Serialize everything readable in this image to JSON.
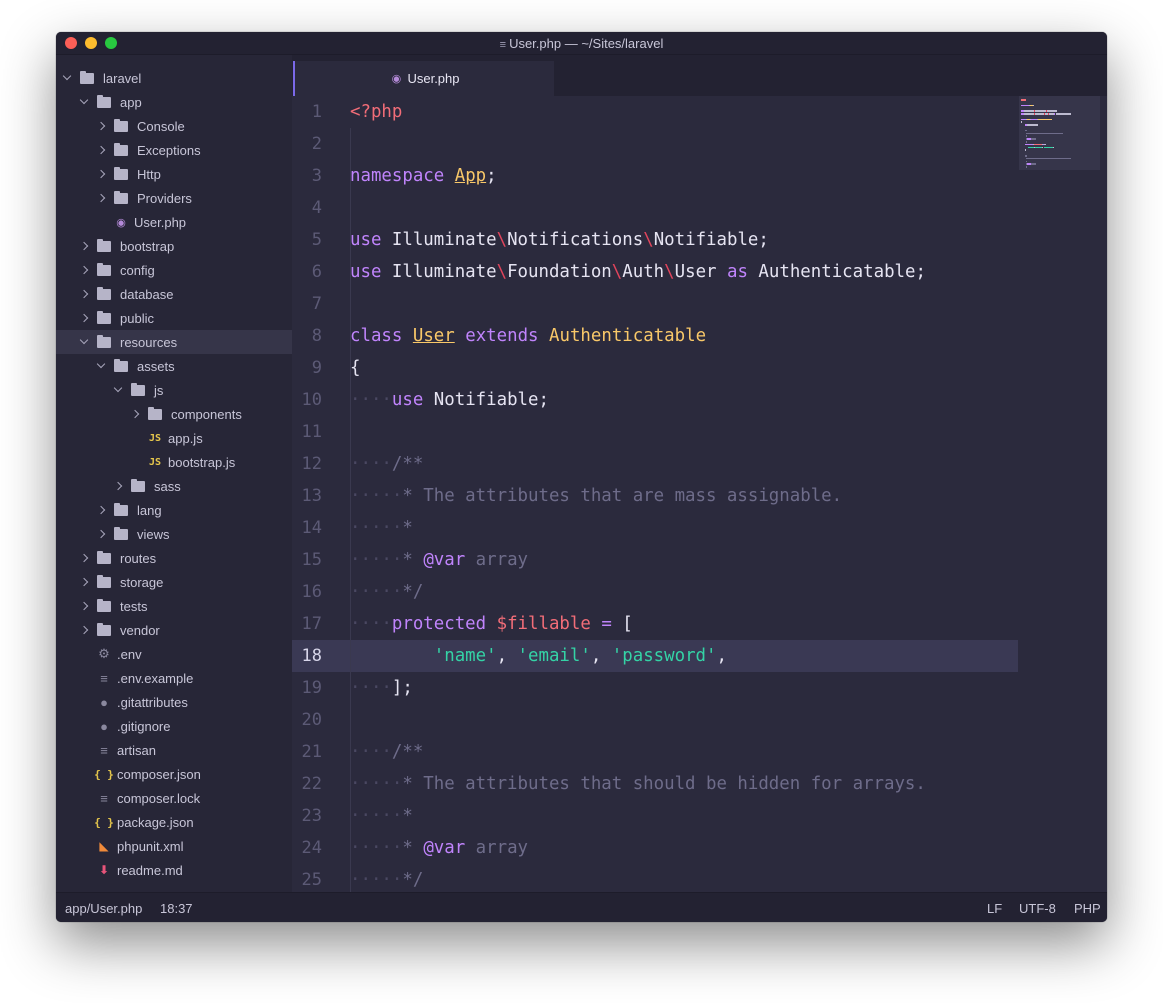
{
  "window": {
    "title": "User.php — ~/Sites/laravel"
  },
  "sidebar": {
    "items": [
      {
        "label": "laravel",
        "type": "folder",
        "state": "open",
        "depth": 0
      },
      {
        "label": "app",
        "type": "folder",
        "state": "open",
        "depth": 1
      },
      {
        "label": "Console",
        "type": "folder",
        "state": "closed",
        "depth": 2
      },
      {
        "label": "Exceptions",
        "type": "folder",
        "state": "closed",
        "depth": 2
      },
      {
        "label": "Http",
        "type": "folder",
        "state": "closed",
        "depth": 2
      },
      {
        "label": "Providers",
        "type": "folder",
        "state": "closed",
        "depth": 2
      },
      {
        "label": "User.php",
        "type": "file",
        "icon": "php-elephant-icon",
        "depth": 2
      },
      {
        "label": "bootstrap",
        "type": "folder",
        "state": "closed",
        "depth": 1
      },
      {
        "label": "config",
        "type": "folder",
        "state": "closed",
        "depth": 1
      },
      {
        "label": "database",
        "type": "folder",
        "state": "closed",
        "depth": 1
      },
      {
        "label": "public",
        "type": "folder",
        "state": "closed",
        "depth": 1
      },
      {
        "label": "resources",
        "type": "folder",
        "state": "open",
        "depth": 1,
        "selected": true
      },
      {
        "label": "assets",
        "type": "folder",
        "state": "open",
        "depth": 2
      },
      {
        "label": "js",
        "type": "folder",
        "state": "open",
        "depth": 3
      },
      {
        "label": "components",
        "type": "folder",
        "state": "closed",
        "depth": 4
      },
      {
        "label": "app.js",
        "type": "file",
        "icon": "js-icon",
        "depth": 4
      },
      {
        "label": "bootstrap.js",
        "type": "file",
        "icon": "js-icon",
        "depth": 4
      },
      {
        "label": "sass",
        "type": "folder",
        "state": "closed",
        "depth": 3
      },
      {
        "label": "lang",
        "type": "folder",
        "state": "closed",
        "depth": 2
      },
      {
        "label": "views",
        "type": "folder",
        "state": "closed",
        "depth": 2
      },
      {
        "label": "routes",
        "type": "folder",
        "state": "closed",
        "depth": 1
      },
      {
        "label": "storage",
        "type": "folder",
        "state": "closed",
        "depth": 1
      },
      {
        "label": "tests",
        "type": "folder",
        "state": "closed",
        "depth": 1
      },
      {
        "label": "vendor",
        "type": "folder",
        "state": "closed",
        "depth": 1
      },
      {
        "label": ".env",
        "type": "file",
        "icon": "gear-icon",
        "depth": 1
      },
      {
        "label": ".env.example",
        "type": "file",
        "icon": "text-file-icon",
        "depth": 1
      },
      {
        "label": ".gitattributes",
        "type": "file",
        "icon": "github-icon",
        "depth": 1
      },
      {
        "label": ".gitignore",
        "type": "file",
        "icon": "github-icon",
        "depth": 1
      },
      {
        "label": "artisan",
        "type": "file",
        "icon": "text-file-icon",
        "depth": 1
      },
      {
        "label": "composer.json",
        "type": "file",
        "icon": "json-braces-icon",
        "depth": 1
      },
      {
        "label": "composer.lock",
        "type": "file",
        "icon": "text-file-icon",
        "depth": 1
      },
      {
        "label": "package.json",
        "type": "file",
        "icon": "json-braces-icon",
        "depth": 1
      },
      {
        "label": "phpunit.xml",
        "type": "file",
        "icon": "rss-feed-icon",
        "depth": 1
      },
      {
        "label": "readme.md",
        "type": "file",
        "icon": "markdown-arrow-icon",
        "depth": 1
      }
    ]
  },
  "tabs": [
    {
      "label": "User.php",
      "icon": "php-elephant-icon",
      "active": true
    }
  ],
  "editor": {
    "current_line": 18,
    "lines": [
      {
        "n": "1",
        "indent": 0,
        "tokens": [
          {
            "t": "<?php",
            "c": "tg"
          }
        ]
      },
      {
        "n": "2",
        "indent": 0,
        "tokens": []
      },
      {
        "n": "3",
        "indent": 0,
        "tokens": [
          {
            "t": "namespace",
            "c": "k"
          },
          {
            "t": " "
          },
          {
            "t": "App",
            "c": "cls ul"
          },
          {
            "t": ";"
          }
        ]
      },
      {
        "n": "4",
        "indent": 0,
        "tokens": []
      },
      {
        "n": "5",
        "indent": 0,
        "tokens": [
          {
            "t": "use",
            "c": "k"
          },
          {
            "t": " Illuminate"
          },
          {
            "t": "\\",
            "c": "bs"
          },
          {
            "t": "Notifications"
          },
          {
            "t": "\\",
            "c": "bs"
          },
          {
            "t": "Notifiable;"
          }
        ]
      },
      {
        "n": "6",
        "indent": 0,
        "tokens": [
          {
            "t": "use",
            "c": "k"
          },
          {
            "t": " Illuminate"
          },
          {
            "t": "\\",
            "c": "bs"
          },
          {
            "t": "Foundation"
          },
          {
            "t": "\\",
            "c": "bs"
          },
          {
            "t": "Auth"
          },
          {
            "t": "\\",
            "c": "bs"
          },
          {
            "t": "User "
          },
          {
            "t": "as",
            "c": "k"
          },
          {
            "t": " Authenticatable;"
          }
        ]
      },
      {
        "n": "7",
        "indent": 0,
        "tokens": []
      },
      {
        "n": "8",
        "indent": 0,
        "tokens": [
          {
            "t": "class",
            "c": "k"
          },
          {
            "t": " "
          },
          {
            "t": "User",
            "c": "cls ul"
          },
          {
            "t": " "
          },
          {
            "t": "extends",
            "c": "k"
          },
          {
            "t": " "
          },
          {
            "t": "Authenticatable",
            "c": "cls"
          }
        ]
      },
      {
        "n": "9",
        "indent": 0,
        "tokens": [
          {
            "t": "{"
          }
        ]
      },
      {
        "n": "10",
        "indent": 4,
        "tokens": [
          {
            "t": "use",
            "c": "k"
          },
          {
            "t": " Notifiable;"
          }
        ]
      },
      {
        "n": "11",
        "indent": 0,
        "tokens": []
      },
      {
        "n": "12",
        "indent": 4,
        "tokens": [
          {
            "t": "/**",
            "c": "cm"
          }
        ]
      },
      {
        "n": "13",
        "indent": 5,
        "tokens": [
          {
            "t": "* The attributes that are mass assignable.",
            "c": "cm"
          }
        ]
      },
      {
        "n": "14",
        "indent": 5,
        "tokens": [
          {
            "t": "*",
            "c": "cm"
          }
        ]
      },
      {
        "n": "15",
        "indent": 5,
        "tokens": [
          {
            "t": "* ",
            "c": "cm"
          },
          {
            "t": "@var",
            "c": "at"
          },
          {
            "t": " array",
            "c": "cm"
          }
        ]
      },
      {
        "n": "16",
        "indent": 5,
        "tokens": [
          {
            "t": "*/",
            "c": "cm"
          }
        ]
      },
      {
        "n": "17",
        "indent": 4,
        "tokens": [
          {
            "t": "protected",
            "c": "k"
          },
          {
            "t": " "
          },
          {
            "t": "$fillable",
            "c": "var"
          },
          {
            "t": " "
          },
          {
            "t": "=",
            "c": "op"
          },
          {
            "t": " ["
          }
        ]
      },
      {
        "n": "18",
        "indent": 8,
        "plain_indent": true,
        "tokens": [
          {
            "t": "'name'",
            "c": "str"
          },
          {
            "t": ", "
          },
          {
            "t": "'email'",
            "c": "str"
          },
          {
            "t": ", "
          },
          {
            "t": "'password'",
            "c": "str"
          },
          {
            "t": ","
          }
        ]
      },
      {
        "n": "19",
        "indent": 4,
        "tokens": [
          {
            "t": "];"
          }
        ]
      },
      {
        "n": "20",
        "indent": 0,
        "tokens": []
      },
      {
        "n": "21",
        "indent": 4,
        "tokens": [
          {
            "t": "/**",
            "c": "cm"
          }
        ]
      },
      {
        "n": "22",
        "indent": 5,
        "tokens": [
          {
            "t": "* The attributes that should be hidden for arrays.",
            "c": "cm"
          }
        ]
      },
      {
        "n": "23",
        "indent": 5,
        "tokens": [
          {
            "t": "*",
            "c": "cm"
          }
        ]
      },
      {
        "n": "24",
        "indent": 5,
        "tokens": [
          {
            "t": "* ",
            "c": "cm"
          },
          {
            "t": "@var",
            "c": "at"
          },
          {
            "t": " array",
            "c": "cm"
          }
        ]
      },
      {
        "n": "25",
        "indent": 5,
        "tokens": [
          {
            "t": "*/",
            "c": "cm"
          }
        ]
      }
    ]
  },
  "statusbar": {
    "file_path": "app/User.php",
    "cursor_position": "18:37",
    "line_ending": "LF",
    "encoding": "UTF-8",
    "grammar": "PHP"
  },
  "colors": {
    "background": "#2b2a3d",
    "sidebar": "#272637",
    "accent": "#7b69e8",
    "keyword": "#c084fc",
    "string": "#34d3a6",
    "class": "#f9c869",
    "tag": "#f26d78"
  }
}
